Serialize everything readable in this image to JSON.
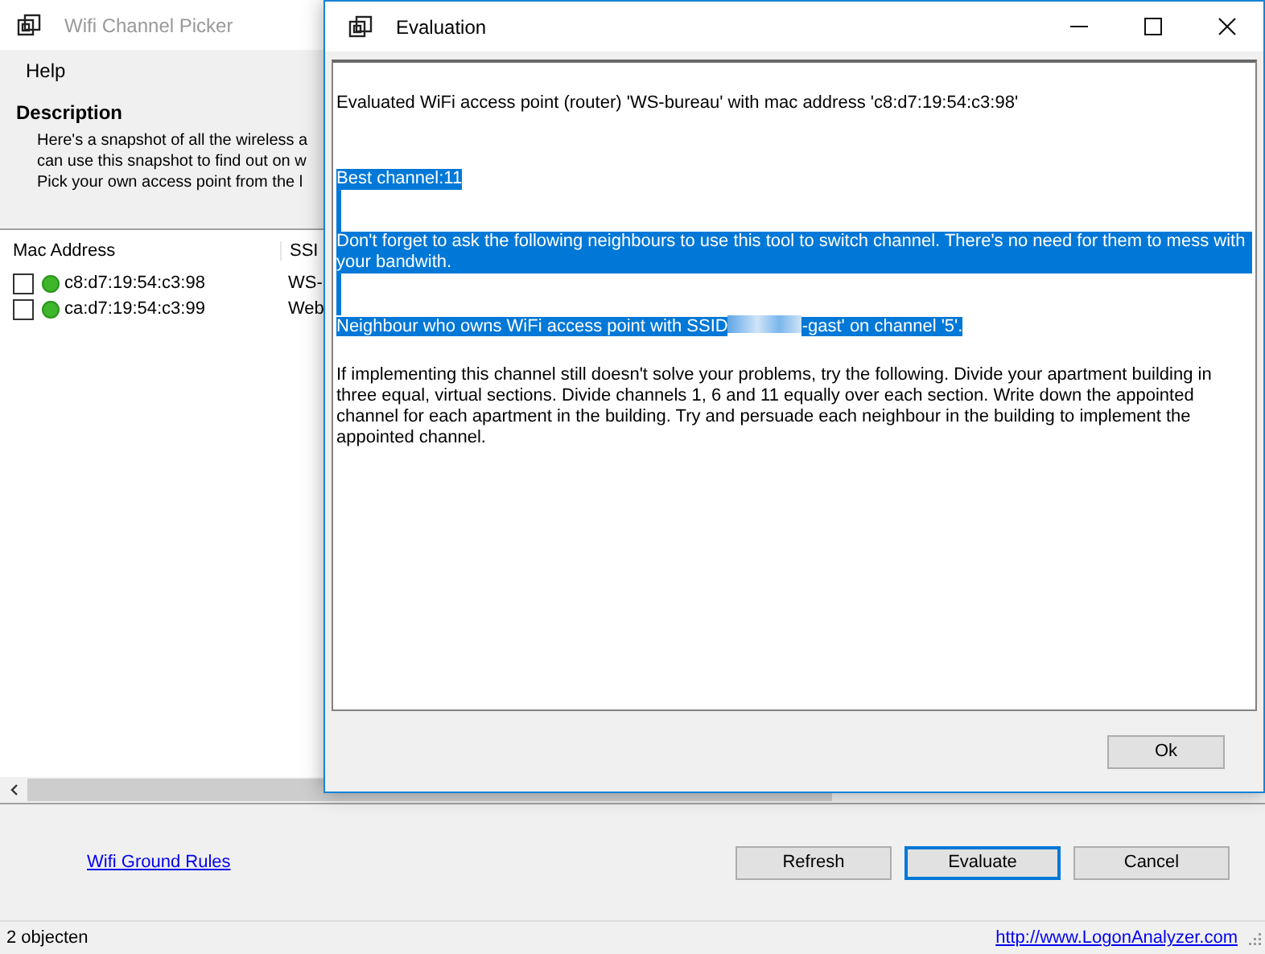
{
  "main_window": {
    "title": "Wifi Channel Picker",
    "menu": [
      {
        "label": "Help"
      }
    ],
    "description": {
      "heading": "Description",
      "lines": [
        "Here's a snapshot of all the wireless a",
        "can use this snapshot to find out on w",
        "Pick your own access point from the l"
      ]
    },
    "list": {
      "columns": [
        "Mac Address",
        "SSI"
      ],
      "rows": [
        {
          "checked": false,
          "color": "#3fb52c",
          "mac": "c8:d7:19:54:c3:98",
          "ssid": "WS-"
        },
        {
          "checked": false,
          "color": "#3fb52c",
          "mac": "ca:d7:19:54:c3:99",
          "ssid": "Web"
        }
      ]
    },
    "link": "Wifi Ground Rules",
    "buttons": [
      {
        "label": "Refresh",
        "focused": false
      },
      {
        "label": "Evaluate",
        "focused": true
      },
      {
        "label": "Cancel",
        "focused": false
      }
    ],
    "status_bar": {
      "text": "2 objecten",
      "link": "http://www.LogonAnalyzer.com"
    }
  },
  "dialog": {
    "title": "Evaluation",
    "lines": [
      {
        "kind": "blank",
        "selected": false
      },
      {
        "kind": "text",
        "text": "Evaluated WiFi access point (router) 'WS-bureau' with mac address 'c8:d7:19:54:c3:98'",
        "selected": false
      },
      {
        "kind": "blank",
        "selected": false
      },
      {
        "kind": "blank",
        "selected": false
      },
      {
        "kind": "text",
        "text": "Best channel:11",
        "selected": true
      },
      {
        "kind": "blank",
        "selected": true
      },
      {
        "kind": "blank",
        "selected": true
      },
      {
        "kind": "text",
        "text": "Don't forget to ask the following neighbours to use this tool to switch channel. There's no need for them to mess with your bandwith.",
        "selected": true
      },
      {
        "kind": "blank",
        "selected": true
      },
      {
        "kind": "blank",
        "selected": true
      },
      {
        "kind": "redacted",
        "before": "Neighbour who owns WiFi access point with SSID",
        "after": "-gast' on channel '5'.",
        "selected": true
      },
      {
        "kind": "blank",
        "selected": false
      },
      {
        "kind": "text",
        "text": "If implementing this channel still doesn't solve your problems, try the following. Divide your apartment building in three equal, virtual sections. Divide channels 1, 6 and 11 equally over each section. Write down the appointed channel for each apartment in the building. Try and persuade each neighbour in the building to implement the appointed channel.",
        "selected": false
      }
    ],
    "button": "Ok"
  }
}
